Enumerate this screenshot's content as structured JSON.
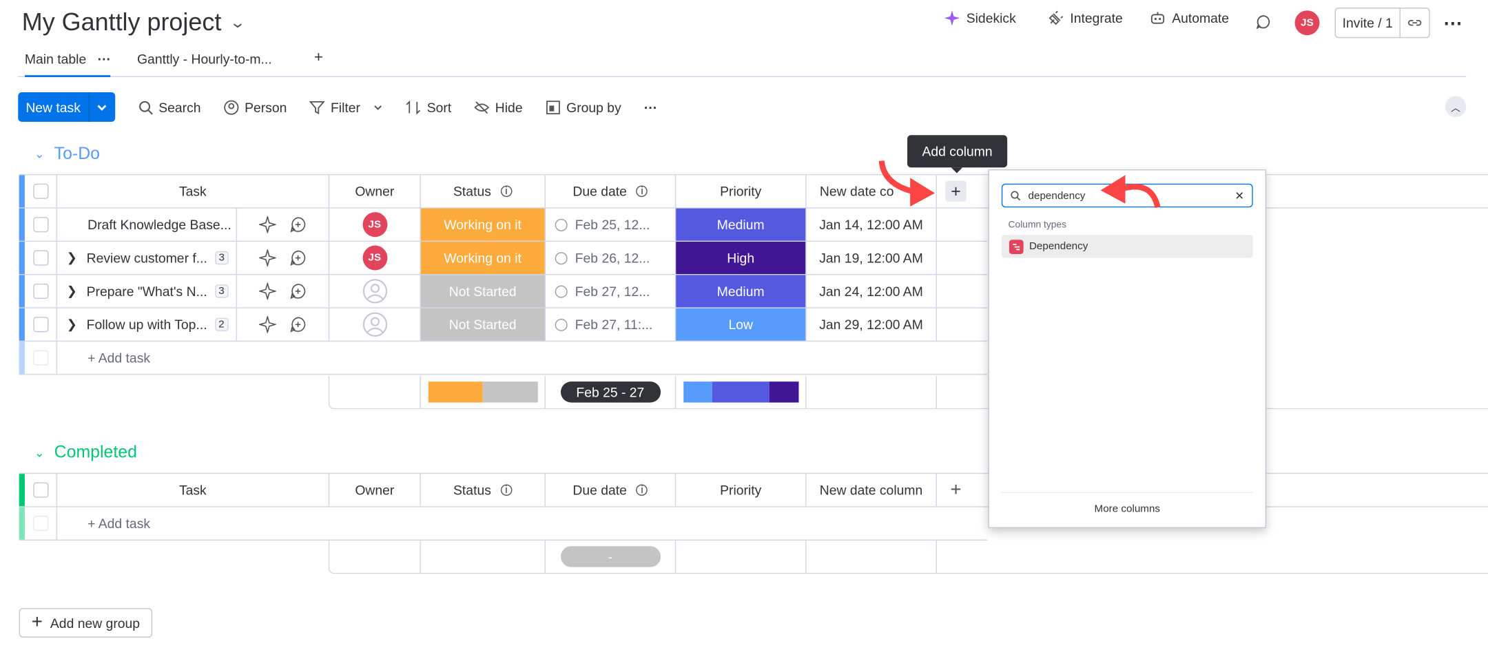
{
  "project": {
    "title": "My Ganttly project"
  },
  "header": {
    "sidekick": "Sidekick",
    "integrate": "Integrate",
    "automate": "Automate",
    "avatar": "JS",
    "invite": "Invite / 1"
  },
  "tabs": [
    {
      "label": "Main table"
    },
    {
      "label": "Ganttly - Hourly-to-m..."
    }
  ],
  "toolbar": {
    "new_task": "New task",
    "search": "Search",
    "person": "Person",
    "filter": "Filter",
    "sort": "Sort",
    "hide": "Hide",
    "group_by": "Group by"
  },
  "columns": {
    "task": "Task",
    "owner": "Owner",
    "status": "Status",
    "due": "Due date",
    "priority": "Priority",
    "newdate": "New date column",
    "newdate_cut": "New date co"
  },
  "groups": [
    {
      "name": "To-Do",
      "color": "#579bfc",
      "rows": [
        {
          "task": "Draft Knowledge Base...",
          "subitems": "",
          "owner": "JS",
          "status": "Working on it",
          "status_color": "#fdab3d",
          "due": "Feb 25, 12...",
          "priority": "Medium",
          "priority_color": "#5559df",
          "newdate": "Jan 14, 12:00 AM"
        },
        {
          "task": "Review customer f...",
          "subitems": "3",
          "owner": "JS",
          "status": "Working on it",
          "status_color": "#fdab3d",
          "due": "Feb 26, 12...",
          "priority": "High",
          "priority_color": "#401694",
          "newdate": "Jan 19, 12:00 AM"
        },
        {
          "task": "Prepare \"What's N...",
          "subitems": "3",
          "owner": "",
          "status": "Not Started",
          "status_color": "#c4c4c4",
          "due": "Feb 27, 12...",
          "priority": "Medium",
          "priority_color": "#5559df",
          "newdate": "Jan 24, 12:00 AM"
        },
        {
          "task": "Follow up with Top...",
          "subitems": "2",
          "owner": "",
          "status": "Not Started",
          "status_color": "#c4c4c4",
          "due": "Feb 27, 11:...",
          "priority": "Low",
          "priority_color": "#579bfc",
          "newdate": "Jan 29, 12:00 AM"
        }
      ],
      "add_task": "+ Add task",
      "due_summary": "Feb 25 - 27"
    },
    {
      "name": "Completed",
      "color": "#00c875",
      "add_task": "+ Add task",
      "due_summary": "-"
    }
  ],
  "tooltip": "Add column",
  "dropdown": {
    "search_value": "dependency",
    "section": "Column types",
    "item": "Dependency",
    "more": "More columns"
  },
  "add_group": "Add new group"
}
